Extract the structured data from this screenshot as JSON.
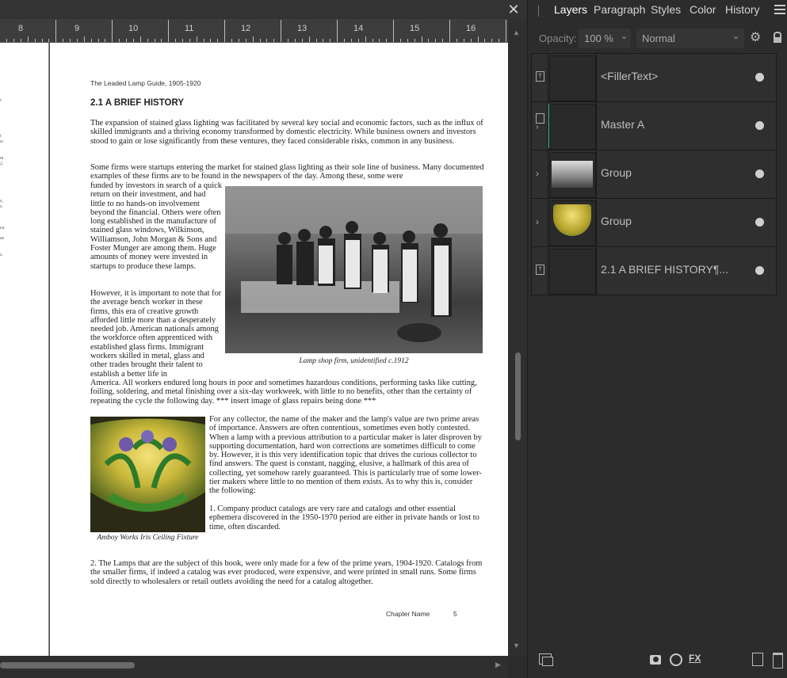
{
  "ruler": {
    "numbers": [
      "8",
      "9",
      "10",
      "11",
      "12",
      "13",
      "14",
      "15",
      "16"
    ]
  },
  "close_icon": "close-icon",
  "page": {
    "running_head": "The Leaded Lamp Guide, 1905-1920",
    "heading": "2.1 A BRIEF HISTORY",
    "para1": "The expansion of stained glass lighting was facilitated by several key social and economic factors, such as the influx of skilled immigrants and a thriving economy transformed by domestic electricity. While business owners and investors stood to gain or lose significantly from these ventures, they faced considerable risks, common in any business.",
    "para2_top": "Some firms were startups entering the market for stained glass lighting as their sole line of business. Many documented examples of these firms are to be found in the newspapers of the day. Among these, some were",
    "para2_wrap": "funded by investors in search of a quick return on their investment, and had little to no hands-on involvement beyond the financial. Others were often long established in the manufacture of stained glass windows, Wilkinson, Williamson, John Morgan & Sons and Foster Munger are among them. Huge amounts of money were invested in startups to produce these lamps.",
    "para3_wrap": "However, it is important to note that for the average bench worker in these firms, this era of creative growth afforded little more than a desperately needed job. American nationals among the workforce often apprenticed with established glass firms. Immigrant workers skilled in metal, glass and other trades brought their talent to establish a better life in",
    "para3_full": "America. All workers endured long hours in poor and sometimes hazardous conditions, performing tasks like cutting, foiling, soldering, and metal finishing over a six-day workweek, with little to no benefits, other than the certainty of repeating the cycle the following day. *** insert image of glass repairs being done ***",
    "photo_caption": "Lamp shop firm, unidentified c.1912",
    "para4": "For any collector, the name of the maker and the lamp's value are two prime areas of importance. Answers are often contentious, sometimes even hotly contested. When a lamp with a previous attribution to a particular maker is later disproven by supporting documentation, hard won corrections are sometimes difficult to come by. However, it is this very identification topic that drives the curious collector to find answers. The quest is constant, nagging, elusive, a hallmark of this area of collecting, yet somehow rarely guaranteed. This is particularly true of some lower-tier makers where little to no mention of them exists. As to why this is, consider the following:",
    "para5": "1. Company product catalogs are very rare and catalogs and other essential ephemera discovered in the 1950-1970 period are either in private hands or lost to time, often discarded.",
    "lamp_caption": "Amboy Works Iris Ceiling Fixture",
    "para6": "2. The Lamps that are the subject of this book, were only made for a few of the prime years, 1904-1920. Catalogs from the smaller firms, if indeed a catalog was ever produced, were expensive, and were printed in small runs. Some firms sold directly to wholesalers or retail outlets avoiding the need for a catalog altogether.",
    "footer_chapter": "Chapter Name",
    "footer_page": "5"
  },
  "panel": {
    "tabs": [
      "Layers",
      "Paragraph",
      "Styles",
      "Color",
      "History"
    ],
    "active_tab": "Layers",
    "opacity_label": "Opacity:",
    "opacity_value": "100 %",
    "blend_mode": "Normal",
    "layers": [
      {
        "name": "<FillerText>",
        "type_icon": "text-frame-icon"
      },
      {
        "name": "Master A",
        "type_icon": "master-page-icon"
      },
      {
        "name": "Group",
        "type_icon": "expand-chevron-icon"
      },
      {
        "name": "Group",
        "type_icon": "expand-chevron-icon"
      },
      {
        "name": "2.1 A BRIEF HISTORY¶...",
        "type_icon": "text-frame-icon"
      }
    ]
  },
  "colors": {
    "accent": "#3fc1a7",
    "panel_bg": "#2c2c2c",
    "canvas_bg": "#4a4a4a"
  }
}
